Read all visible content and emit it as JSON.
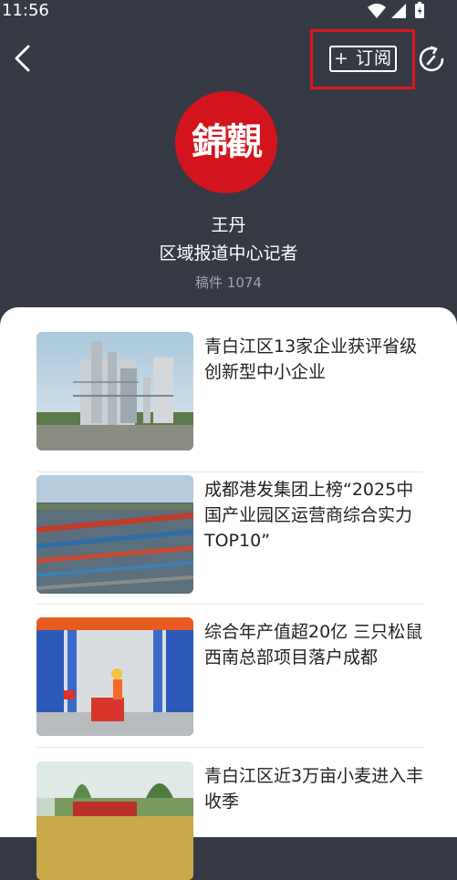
{
  "status": {
    "time": "11:56"
  },
  "header": {
    "subscribe_label": "+ 订阅"
  },
  "profile": {
    "logo_text": "錦觀",
    "name": "王丹",
    "title": "区域报道中心记者",
    "post_count": "稿件 1074"
  },
  "articles": [
    {
      "title": "青白江区13家企业获评省级创新型中小企业"
    },
    {
      "title": "成都港发集团上榜“2025中国产业园区运营商综合实力TOP10”"
    },
    {
      "title": "综合年产值超20亿 三只松鼠西南总部项目落户成都"
    },
    {
      "title": "青白江区近3万亩小麦进入丰收季"
    }
  ]
}
